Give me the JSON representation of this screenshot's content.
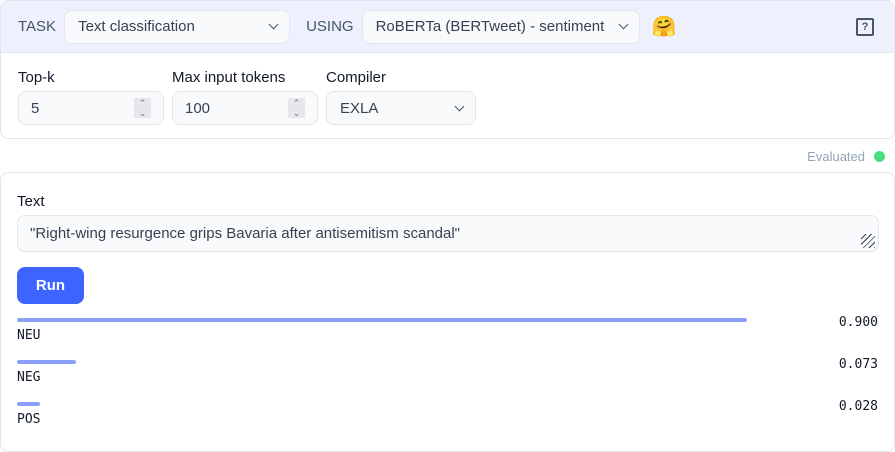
{
  "header": {
    "task_label": "TASK",
    "task_value": "Text classification",
    "using_label": "USING",
    "model_value": "RoBERTa (BERTweet) - sentiment",
    "hf_icon": "🤗"
  },
  "fields": {
    "topk_label": "Top-k",
    "topk_value": "5",
    "max_tokens_label": "Max input tokens",
    "max_tokens_value": "100",
    "compiler_label": "Compiler",
    "compiler_value": "EXLA"
  },
  "status": "Evaluated",
  "output": {
    "text_label": "Text",
    "text_value": "\"Right-wing resurgence grips Bavaria after antisemitism scandal\"",
    "run_label": "Run",
    "results": [
      {
        "label": "NEU",
        "score": "0.900",
        "value": 0.9
      },
      {
        "label": "NEG",
        "score": "0.073",
        "value": 0.073
      },
      {
        "label": "POS",
        "score": "0.028",
        "value": 0.028
      }
    ]
  },
  "colors": {
    "accent": "#3e64ff",
    "bar": "#8aa0fb",
    "status": "#4ade80"
  }
}
